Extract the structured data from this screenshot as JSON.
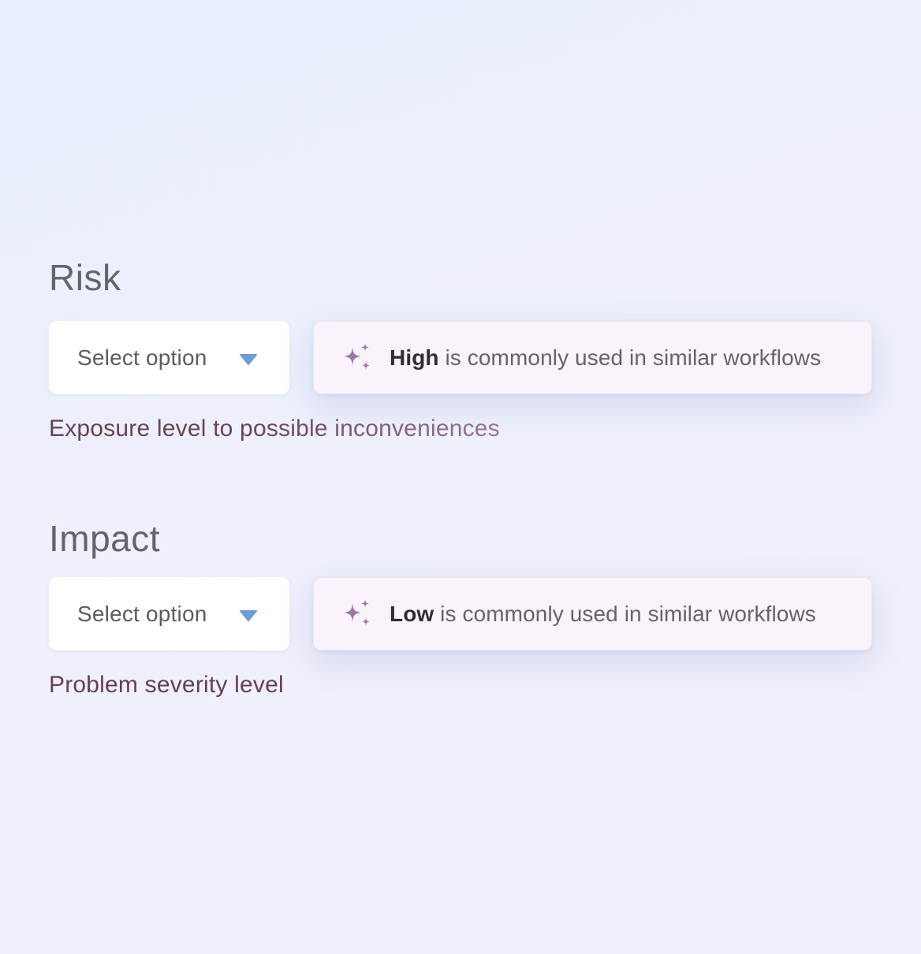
{
  "fields": [
    {
      "label": "Risk",
      "select_placeholder": "Select option",
      "suggestion_value": "High",
      "suggestion_rest": " is commonly used in similar workflows",
      "helper": "Exposure level to possible inconveniences"
    },
    {
      "label": "Impact",
      "select_placeholder": "Select option",
      "suggestion_value": "Low",
      "suggestion_rest": " is commonly used in similar workflows",
      "helper": "Problem severity level"
    }
  ],
  "icons": {
    "chevron": "chevron-down-icon",
    "sparkle": "sparkle-icon"
  },
  "colors": {
    "chevron": "#6f9bd6",
    "sparkle": "#9c7aa6",
    "helper_text": "#6a3e4e",
    "suggestion_bg": "#fbf3fc"
  }
}
